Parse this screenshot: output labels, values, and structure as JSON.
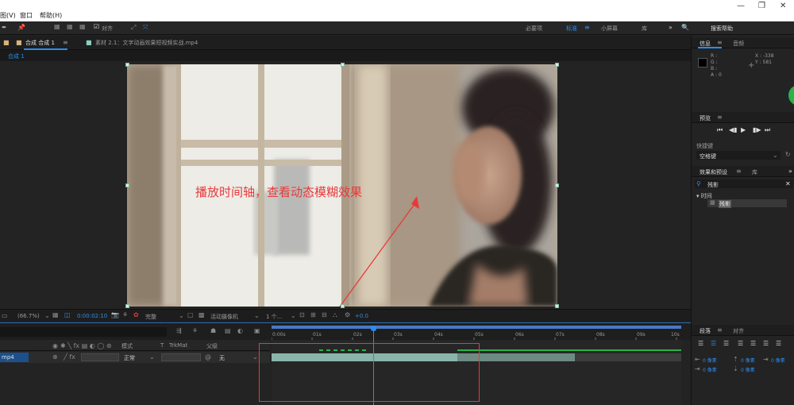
{
  "menubar": {
    "items": [
      "图(V)",
      "窗口",
      "帮助(H)"
    ]
  },
  "toolbar": {
    "snap_label": "对齐",
    "workspaces": [
      "必要项",
      "标准",
      "小屏幕",
      "库"
    ],
    "active_workspace": "标准",
    "search_placeholder": "搜索帮助"
  },
  "comp_panel": {
    "tabs": [
      "合成 合成 1",
      "素材 2.1：文字动画效果短视频实战.mp4"
    ],
    "sub_tab": "合成 1"
  },
  "viewer": {
    "annotation": "播放时间轴，查看动态模糊效果",
    "zoom": "(66.7%)",
    "timecode": "0:00:02:10",
    "resolution": "完整",
    "camera": "活动摄像机",
    "views": "1 个...",
    "exposure": "+0.0"
  },
  "timeline": {
    "columns": [
      "模式",
      "T",
      "TrkMat",
      "父级"
    ],
    "layer_name": "mp4",
    "layer_mode": "正常",
    "layer_parent": "无",
    "ruler_ticks": [
      "0:00s",
      "01s",
      "02s",
      "03s",
      "04s",
      "05s",
      "06s",
      "07s",
      "08s",
      "09s",
      "10s"
    ],
    "playhead_time_s": 2.5
  },
  "right_panel": {
    "info_tab": "信息",
    "audio_tab": "音频",
    "info_values": {
      "r": "R :",
      "g": "G :",
      "b": "B :",
      "a": "A : 0",
      "x": "X : -338",
      "y": "Y : 581"
    },
    "preview_tab": "预览",
    "shortcut_label": "快捷键",
    "shortcut_value": "空格键",
    "effects_tab": "效果和预设",
    "library_tab": "库",
    "effects_search": "残影",
    "tree_category": "▾ 时间",
    "tree_item": "残影",
    "paragraph_tab": "段落",
    "align_tab": "对齐",
    "px_label": "0 像素"
  },
  "colors": {
    "accent": "#2d8ceb",
    "annotation": "#e8393a",
    "green": "#29b34a",
    "work_area": "#8ab5aa"
  }
}
